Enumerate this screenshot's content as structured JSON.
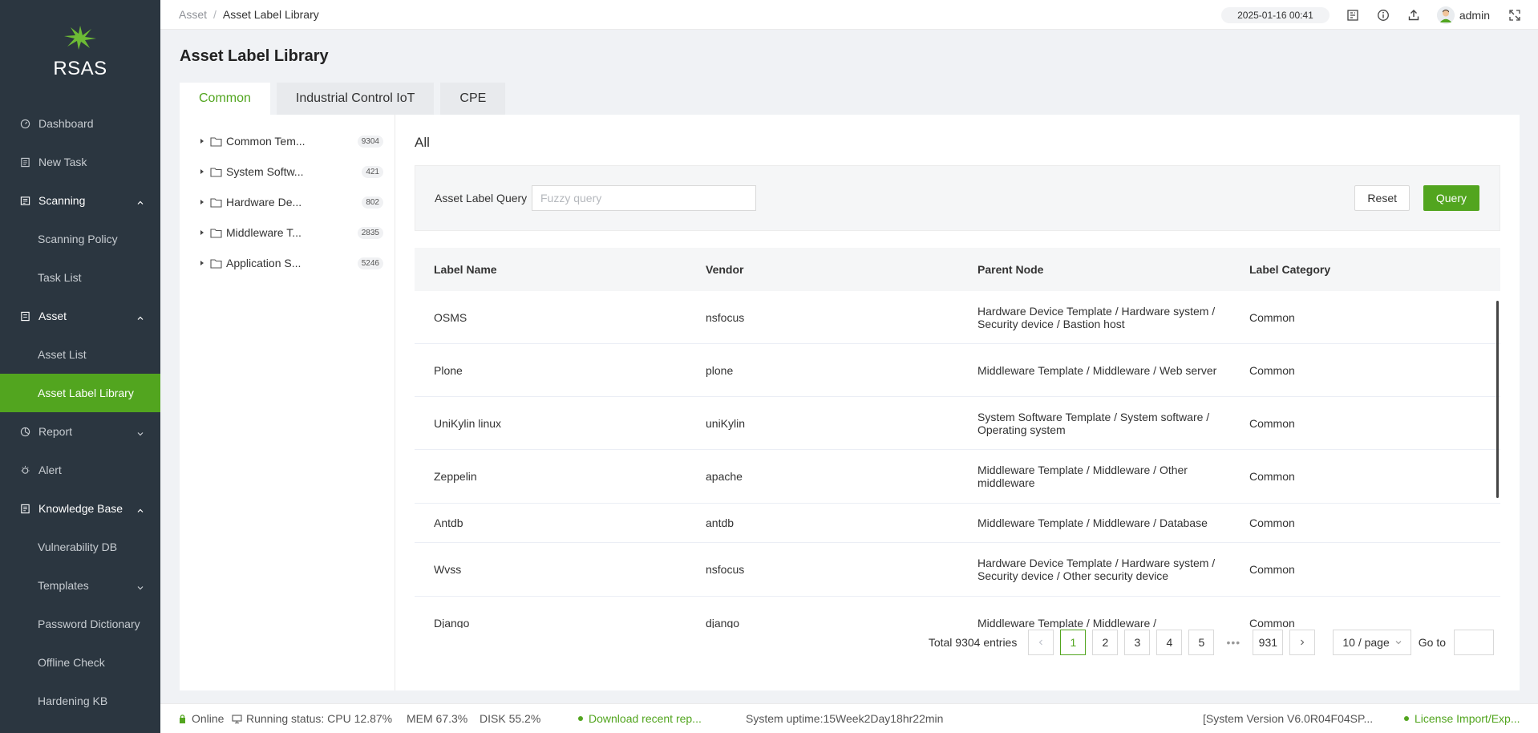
{
  "app": {
    "name": "RSAS"
  },
  "sidebar": {
    "items": [
      {
        "label": "Dashboard",
        "icon": "dashboard-icon"
      },
      {
        "label": "New Task",
        "icon": "new-task-icon"
      },
      {
        "label": "Scanning",
        "icon": "scanning-icon",
        "expanded": true
      },
      {
        "label": "Scanning Policy"
      },
      {
        "label": "Task List"
      },
      {
        "label": "Asset",
        "icon": "asset-icon",
        "expanded": true
      },
      {
        "label": "Asset List"
      },
      {
        "label": "Asset Label Library",
        "active": true
      },
      {
        "label": "Report",
        "icon": "report-icon",
        "expanded": false
      },
      {
        "label": "Alert",
        "icon": "alert-icon"
      },
      {
        "label": "Knowledge Base",
        "icon": "knowledge-base-icon",
        "expanded": true
      },
      {
        "label": "Vulnerability DB"
      },
      {
        "label": "Templates",
        "expanded": false
      },
      {
        "label": "Password Dictionary"
      },
      {
        "label": "Offline Check"
      },
      {
        "label": "Hardening KB"
      }
    ]
  },
  "header": {
    "breadcrumb": {
      "parent": "Asset",
      "separator": "/",
      "current": "Asset Label Library"
    },
    "datetime": "2025-01-16 00:41",
    "user": "admin"
  },
  "page": {
    "title": "Asset Label Library",
    "tabs": [
      {
        "label": "Common",
        "active": true
      },
      {
        "label": "Industrial Control IoT"
      },
      {
        "label": "CPE"
      }
    ]
  },
  "tree": [
    {
      "label": "Common Tem...",
      "count": "9304"
    },
    {
      "label": "System Softw...",
      "count": "421"
    },
    {
      "label": "Hardware De...",
      "count": "802"
    },
    {
      "label": "Middleware T...",
      "count": "2835"
    },
    {
      "label": "Application S...",
      "count": "5246"
    }
  ],
  "content": {
    "scope_label": "All",
    "query": {
      "label": "Asset Label Query",
      "placeholder": "Fuzzy query",
      "reset_label": "Reset",
      "query_label": "Query"
    }
  },
  "table": {
    "headers": [
      "Label Name",
      "Vendor",
      "Parent Node",
      "Label Category"
    ],
    "rows": [
      [
        "OSMS",
        "nsfocus",
        "Hardware Device Template / Hardware system / Security device / Bastion host",
        "Common"
      ],
      [
        "Plone",
        "plone",
        "Middleware Template / Middleware / Web server",
        "Common"
      ],
      [
        "UniKylin linux",
        "uniKylin",
        "System Software Template / System software / Operating system",
        "Common"
      ],
      [
        "Zeppelin",
        "apache",
        "Middleware Template / Middleware / Other middleware",
        "Common"
      ],
      [
        "Antdb",
        "antdb",
        "Middleware Template / Middleware / Database",
        "Common"
      ],
      [
        "Wvss",
        "nsfocus",
        "Hardware Device Template / Hardware system / Security device / Other security device",
        "Common"
      ],
      [
        "Django",
        "django",
        "Middleware Template / Middleware /",
        "Common"
      ]
    ]
  },
  "pagination": {
    "total": "Total 9304 entries",
    "pages": [
      "1",
      "2",
      "3",
      "4",
      "5"
    ],
    "ellipsis": "•••",
    "last_page": "931",
    "current_page": 1,
    "page_size": "10 / page",
    "goto_label": "Go to"
  },
  "statusbar": {
    "online": "Online",
    "running": "Running status: CPU 12.87%",
    "mem": "MEM 67.3%",
    "disk": "DISK 55.2%",
    "download": "Download recent rep...",
    "uptime": "System uptime:15Week2Day18hr22min",
    "version": "[System Version V6.0R04F04SP...",
    "license": "License Import/Exp..."
  },
  "colors": {
    "accent": "#52a51f",
    "sidebar_bg": "#2b3640"
  }
}
